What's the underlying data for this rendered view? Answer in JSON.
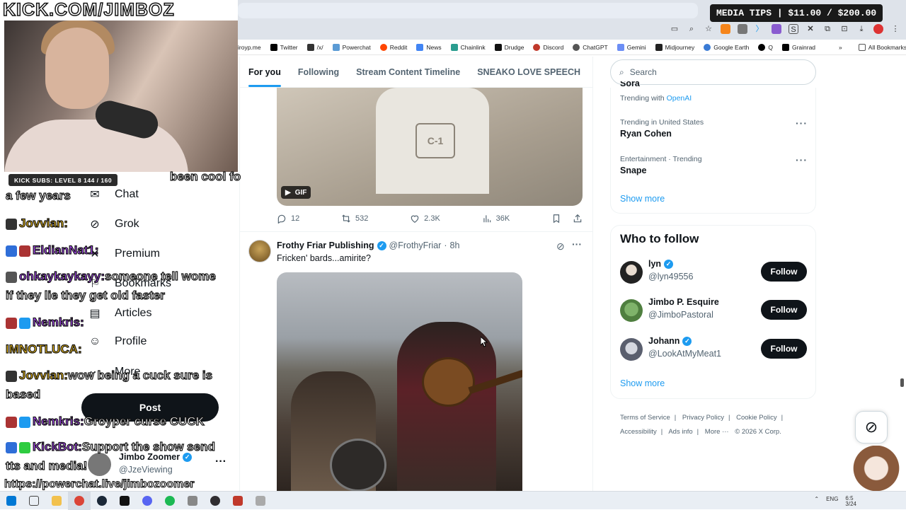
{
  "stream": {
    "channel_title": "KICK.COM/JIMBOZ",
    "subs_badge": "KICK SUBS: LEVEL 8 144 / 160",
    "media_tips": "MEDIA TIPS | $11.00 / $200.00",
    "bottom_link": "https://powerchat.live/jimbozoomer",
    "chat": [
      {
        "user": "",
        "text": "been cool fo"
      },
      {
        "user": "",
        "text": "a few years"
      },
      {
        "user": "Jovvian:",
        "text": ""
      },
      {
        "user": "EldianNat1:",
        "text": ""
      },
      {
        "user": "ohkaykaykayy:",
        "text": "someone tell wome"
      },
      {
        "user": "",
        "text": "if they lie they get old faster"
      },
      {
        "user": "Nemkris:",
        "text": ""
      },
      {
        "user": "IMNOTLUCA:",
        "text": ""
      },
      {
        "user": "Jovvian:",
        "text": "wow being a cuck sure is"
      },
      {
        "user": "",
        "text": "based"
      },
      {
        "user": "Nemkris:",
        "text": "Groyper curse CUCK"
      },
      {
        "user": "KickBot:",
        "text": "Support the show send"
      },
      {
        "user": "",
        "text": "tts and media!"
      }
    ]
  },
  "browser": {
    "bookmarks": [
      "iroyp.me",
      "Twitter",
      "/x/",
      "Powerchat",
      "Reddit",
      "News",
      "Chainlink",
      "Drudge",
      "Discord",
      "ChatGPT",
      "Gemini",
      "Midjourney",
      "Google Earth",
      "Q",
      "Grainrad"
    ],
    "all_bookmarks": "All Bookmarks",
    "overflow": "»"
  },
  "x_nav": {
    "items": [
      {
        "label": "Chat",
        "icon": "mail-icon"
      },
      {
        "label": "Grok",
        "icon": "grok-icon"
      },
      {
        "label": "Premium",
        "icon": "x-premium-icon"
      },
      {
        "label": "Bookmarks",
        "icon": "bookmark-icon"
      },
      {
        "label": "Articles",
        "icon": "articles-icon"
      },
      {
        "label": "Profile",
        "icon": "person-icon"
      },
      {
        "label": "More",
        "icon": "more-circle-icon"
      }
    ],
    "post_label": "Post",
    "account": {
      "name": "Jimbo Zoomer",
      "handle": "@JzeViewing",
      "more": "···"
    }
  },
  "timeline": {
    "tabs": [
      "For you",
      "Following",
      "Stream Content Timeline",
      "SNEAKO LOVE SPEECH"
    ],
    "active_tab": 0,
    "gif_post": {
      "gif_label": "GIF",
      "patch_text": "C-1",
      "replies": "12",
      "reposts": "532",
      "likes": "2.3K",
      "views": "36K"
    },
    "post": {
      "author": "Frothy Friar Publishing",
      "handle": "@FrothyFriar",
      "separator": "·",
      "time": "8h",
      "text": "Fricken' bards...amirite?",
      "more": "···"
    }
  },
  "sidebar": {
    "search_placeholder": "Search",
    "trends": [
      {
        "context": "Trending with",
        "highlight": "OpenAI",
        "name": "Sora"
      },
      {
        "context": "Trending in United States",
        "name": "Ryan Cohen"
      },
      {
        "context": "Entertainment · Trending",
        "name": "Snape"
      }
    ],
    "show_more": "Show more",
    "who_to_follow": {
      "title": "Who to follow",
      "follow_label": "Follow",
      "accounts": [
        {
          "name": "lyn",
          "handle": "@lyn49556"
        },
        {
          "name": "Jimbo P. Esquire",
          "handle": "@JimboPastoral"
        },
        {
          "name": "Johann",
          "handle": "@LookAtMyMeat1"
        }
      ],
      "show_more": "Show more"
    },
    "footer": [
      "Terms of Service",
      "Privacy Policy",
      "Cookie Policy",
      "Accessibility",
      "Ads info",
      "More ···",
      "© 2026 X Corp."
    ]
  },
  "taskbar": {
    "lang": "ENG",
    "time": "6:5",
    "date": "3/24"
  },
  "colors": {
    "accent": "#1d9bf0",
    "text": "#0f1419",
    "muted": "#536471",
    "chat_user": "#b14bff"
  }
}
